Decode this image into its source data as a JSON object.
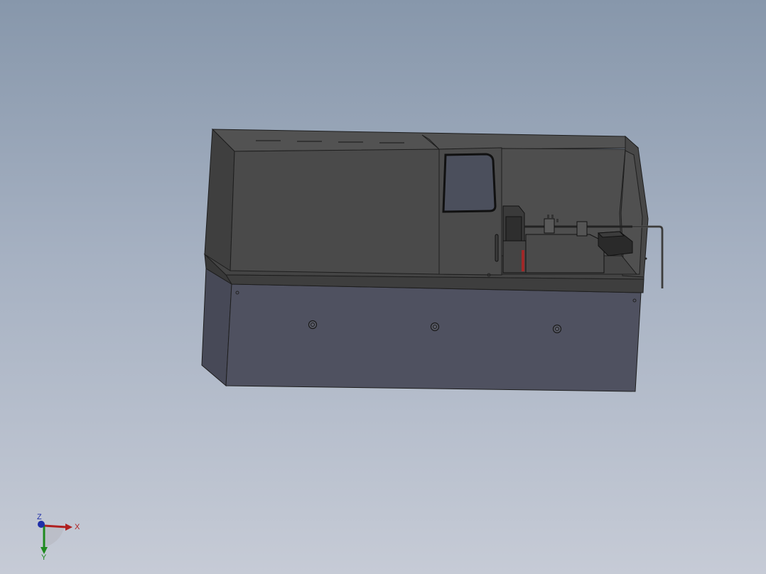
{
  "viewport": {
    "background_top": "#8797ab",
    "background_bottom": "#c6cbd6"
  },
  "model": {
    "colors": {
      "cabinet": "#4a4a4a",
      "cabinet_dark": "#3a3a3a",
      "cabinet_light": "#5a5a5a",
      "base": "#4f5160",
      "base_side": "#474957",
      "window_glass": "#4b4f5c",
      "edge": "#1e1e1e",
      "red_part": "#a02828"
    }
  },
  "triad": {
    "x_label": "X",
    "y_label": "Y",
    "z_label": "Z",
    "x_color": "#b02020",
    "y_color": "#1e8a1e",
    "z_color": "#1f2fa8"
  }
}
